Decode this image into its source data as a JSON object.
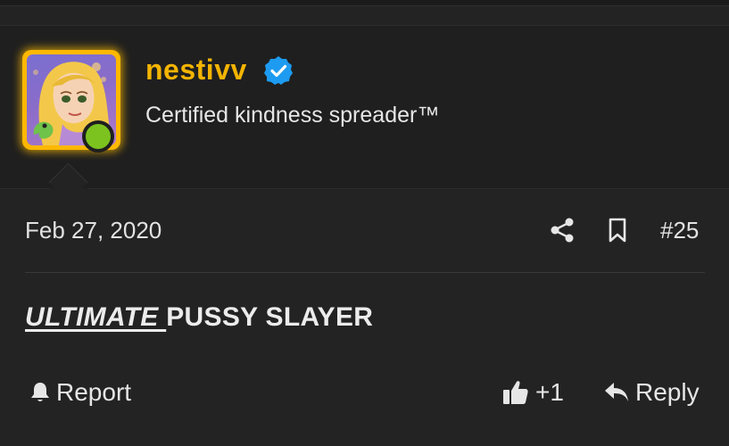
{
  "user": {
    "name": "nestivv",
    "title": "Certified kindness spreader™",
    "avatar_icon": "avatar-cartoon-blonde-princess",
    "verified_icon": "verified-check-badge-icon",
    "status": "online"
  },
  "post": {
    "date": "Feb 27, 2020",
    "number": "#25",
    "body_emphasis": "ULTIMATE ",
    "body_rest": "PUSSY SLAYER"
  },
  "actions": {
    "report_label": "Report",
    "like_count": "+1",
    "reply_label": "Reply"
  },
  "colors": {
    "background": "#232323",
    "header_background": "#1f1f1f",
    "username": "#f4b400",
    "avatar_glow": "#ffb800",
    "online_dot": "#7cc31f",
    "verified_badge": "#1d9bf0"
  }
}
